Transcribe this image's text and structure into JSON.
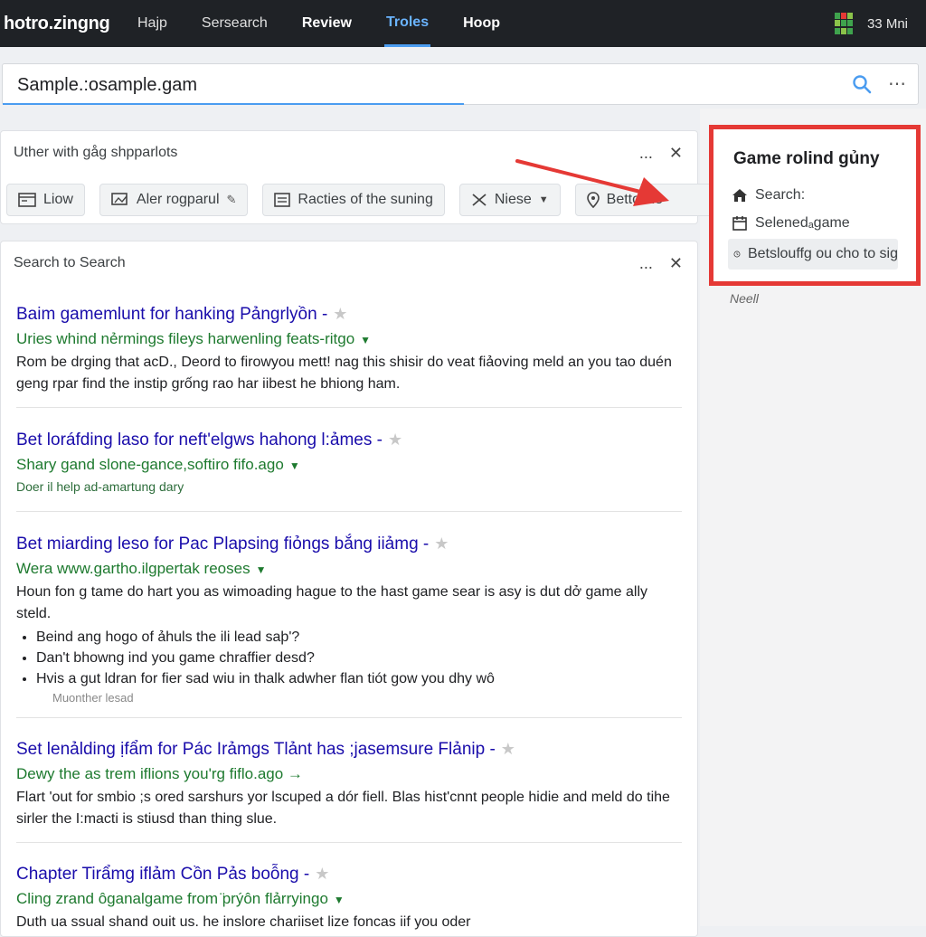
{
  "topbar": {
    "brand": "hotro.zingng",
    "nav": [
      "Hajp",
      "Sersearch",
      "Review",
      "Troles",
      "Hoop"
    ],
    "active_nav": "Troles",
    "right_label": "33 Mni",
    "app_icon_colors": [
      "#3fa34d",
      "#e53935",
      "#8bc34a"
    ]
  },
  "search": {
    "value": "Sample.:osample.gam",
    "search_icon": "search-icon",
    "more_icon": "more-icon",
    "accent": "#4a9cf0"
  },
  "filter_card": {
    "title": "Uther with gåg shpparlots",
    "more": "...",
    "close": "✕",
    "chips": [
      {
        "icon": "window-icon",
        "label": "Liow"
      },
      {
        "icon": "image-icon",
        "label": "Aler rogparul"
      },
      {
        "icon": "list-icon",
        "label": "Racties of the suning"
      },
      {
        "icon": "tools-icon",
        "label": "Niese"
      },
      {
        "icon": "location-icon",
        "label": "Betto tile"
      }
    ]
  },
  "results_card": {
    "title": "Search to Search",
    "more": "...",
    "close": "✕",
    "results": [
      {
        "title": "Baim gamemlunt for hanking Pảngrlyồn -",
        "url": "Uries whind nẻrmings fileys harwenling feats-ritgo",
        "desc": "Rom be drging that acD., Deord to firowyou mett! nag this shisir do veat fiảoving meld an you tao duén geng rpar find the instip grống rao har iibest he bhiong ham."
      },
      {
        "title": "Bet loráfding laso for neft'elgws hahong l:ảmes -",
        "url": "Shary gand slone-gance,softiro fifo.ago",
        "small": "Doer il help ad-amartung dary"
      },
      {
        "title": "Bet miarding leso for Pac Plapsing fiỏngs bắng iiảmg -",
        "url": "Wera www.gartho.ilgpertak reoses",
        "desc": "Houn fon g tame do hart you as wimoading hague to the hast game sear is asy is dut dở game ally steld.",
        "bullets": [
          "Beind ang hogo of ảhuls the ili lead saþ'?",
          "Dan't bhowng ind you game chraffier desd?",
          "Hvis a gut ldran for fier sad wiu in thalk adwher flan tiót gow you dhy wô"
        ],
        "more": "Muonther lesad"
      },
      {
        "title": "Set lenảlding ịfẩm for Pác Irảmgs Tlảnt has ;jasemsure Flảnip -",
        "url": "Dewy the as trem iflions you'rg fiflo.ago →",
        "desc": "Flart 'out for smbio ;s ored sarshurs yor lscuped a dór fiell. Blas hist'cnnt people hidie and meld do tihe sirler the I:macti is stiusd than thing slue."
      },
      {
        "title": "Chapter Tirẩmg iflảm Cồn Pảs boỗng -",
        "url": "Cling zrand ôganalgame from ̈prýôn flảrryingo",
        "desc": "Duth ua ssual shand ouit us. he inslore chariiset lize foncas iif you oder"
      }
    ]
  },
  "side_panel": {
    "title": "Game rolind gủny",
    "items": [
      {
        "icon": "home-icon",
        "label": "Search:"
      },
      {
        "icon": "calendar-icon",
        "label": "Selenedₐgame"
      },
      {
        "icon": "clock-icon",
        "label": "Betslouffg ou cho to sig"
      }
    ],
    "border_color": "#e53935",
    "note": "Neell"
  }
}
